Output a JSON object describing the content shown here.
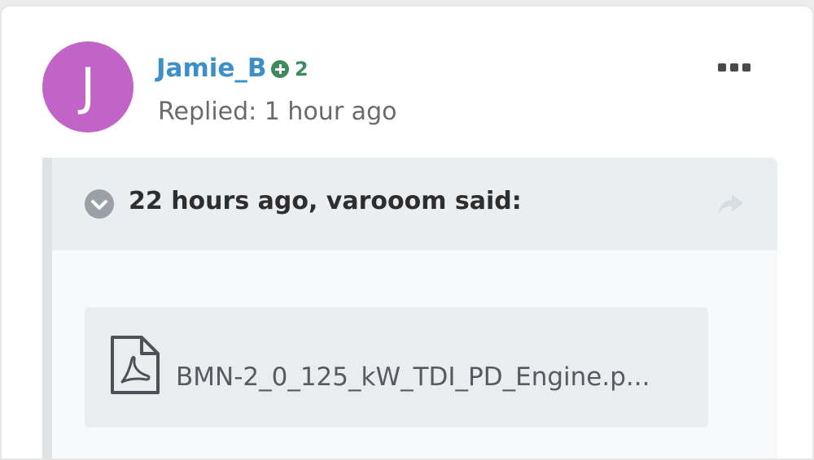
{
  "post": {
    "avatar_letter": "J",
    "username": "Jamie_B",
    "reputation": "2",
    "replied": "Replied: 1 hour ago",
    "avatar_color": "#c163c7",
    "username_color": "#3d8fc7",
    "reputation_color": "#3e8a5e"
  },
  "quote": {
    "title": "22 hours ago, varooom said:",
    "attachment": {
      "icon": "pdf-file-icon",
      "file_name": "BMN-2_0_125_kW_TDI_PD_Engine.p..."
    }
  },
  "icons": {
    "more": "more-options-icon",
    "collapse": "chevron-down-icon",
    "share": "share-arrow-icon",
    "reputation": "plus-circle-icon"
  }
}
